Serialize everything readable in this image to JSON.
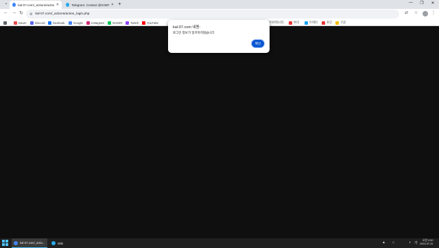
{
  "tabs": [
    {
      "title": "kal-07.com/_actions/action_lc",
      "favicon_color": "#4285f4",
      "active": true
    },
    {
      "title": "Telegram: Contact @KOBTCH",
      "favicon_color": "#29a9eb",
      "active": false
    }
  ],
  "new_tab_label": "+",
  "window_controls": {
    "minimize": "⌄",
    "min": "—",
    "max": "❐",
    "close": "✕"
  },
  "address_bar": {
    "url": "kal-07.com/_actions/action_login.php"
  },
  "bookmarks_left": [
    {
      "label": "Daum",
      "color": "#e34c4c"
    },
    {
      "label": "Discord",
      "color": "#5865f2"
    },
    {
      "label": "facebook",
      "color": "#1877f2"
    },
    {
      "label": "Google",
      "color": "#4285f4"
    },
    {
      "label": "Instagram",
      "color": "#d62976"
    },
    {
      "label": "NAVER",
      "color": "#03c75a"
    },
    {
      "label": "Twitch",
      "color": "#9146ff"
    },
    {
      "label": "YouTube",
      "color": "#ff0000"
    }
  ],
  "bookmarks_right": [
    {
      "label": "아이커뮤니티",
      "color": "#f5f5f5"
    },
    {
      "label": "루리",
      "color": "#e53935"
    },
    {
      "label": "트위터",
      "color": "#1da1f2"
    },
    {
      "label": "포인",
      "color": "#e53935"
    },
    {
      "label": "구글",
      "color": "#fbbc05"
    }
  ],
  "dialog": {
    "title": "kal-07.com 내용:",
    "message": "로그인 정보가 일치하지않습니다",
    "ok_label": "확인"
  },
  "taskbar": {
    "items": [
      {
        "label": "kal-07.com/_actio...",
        "color": "#4285f4",
        "active": true
      },
      {
        "label": "Wiki",
        "color": "#29a9eb",
        "active": false
      }
    ],
    "clock_time": "오전 2:50",
    "clock_date": "2023-07-31"
  }
}
